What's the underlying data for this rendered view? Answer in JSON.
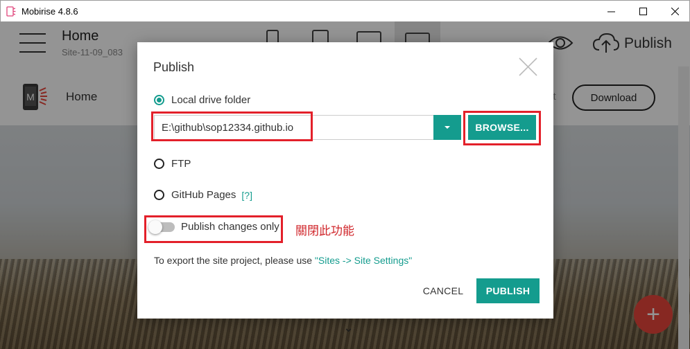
{
  "window": {
    "title": "Mobirise 4.8.6"
  },
  "header": {
    "page_name": "Home",
    "site_name": "Site-11-09_083",
    "publish_label": "Publish"
  },
  "nav": {
    "home": "Home",
    "partial_text": "ct",
    "download": "Download"
  },
  "dialog": {
    "title": "Publish",
    "options": {
      "local": "Local drive folder",
      "ftp": "FTP",
      "github": "GitHub Pages",
      "github_help": "[?]"
    },
    "selected_option": "local",
    "path_value": "E:\\github\\sop12334.github.io",
    "browse_label": "BROWSE...",
    "toggle_label": "Publish changes only",
    "toggle_on": false,
    "export_note": "To export the site project, please use ",
    "export_link": "\"Sites -> Site Settings\"",
    "cancel_label": "CANCEL",
    "publish_label": "PUBLISH"
  },
  "annotation": {
    "text": "關閉此功能"
  },
  "colors": {
    "accent": "#149c8e",
    "annotation": "#e3202a",
    "fab": "#e8453c"
  }
}
